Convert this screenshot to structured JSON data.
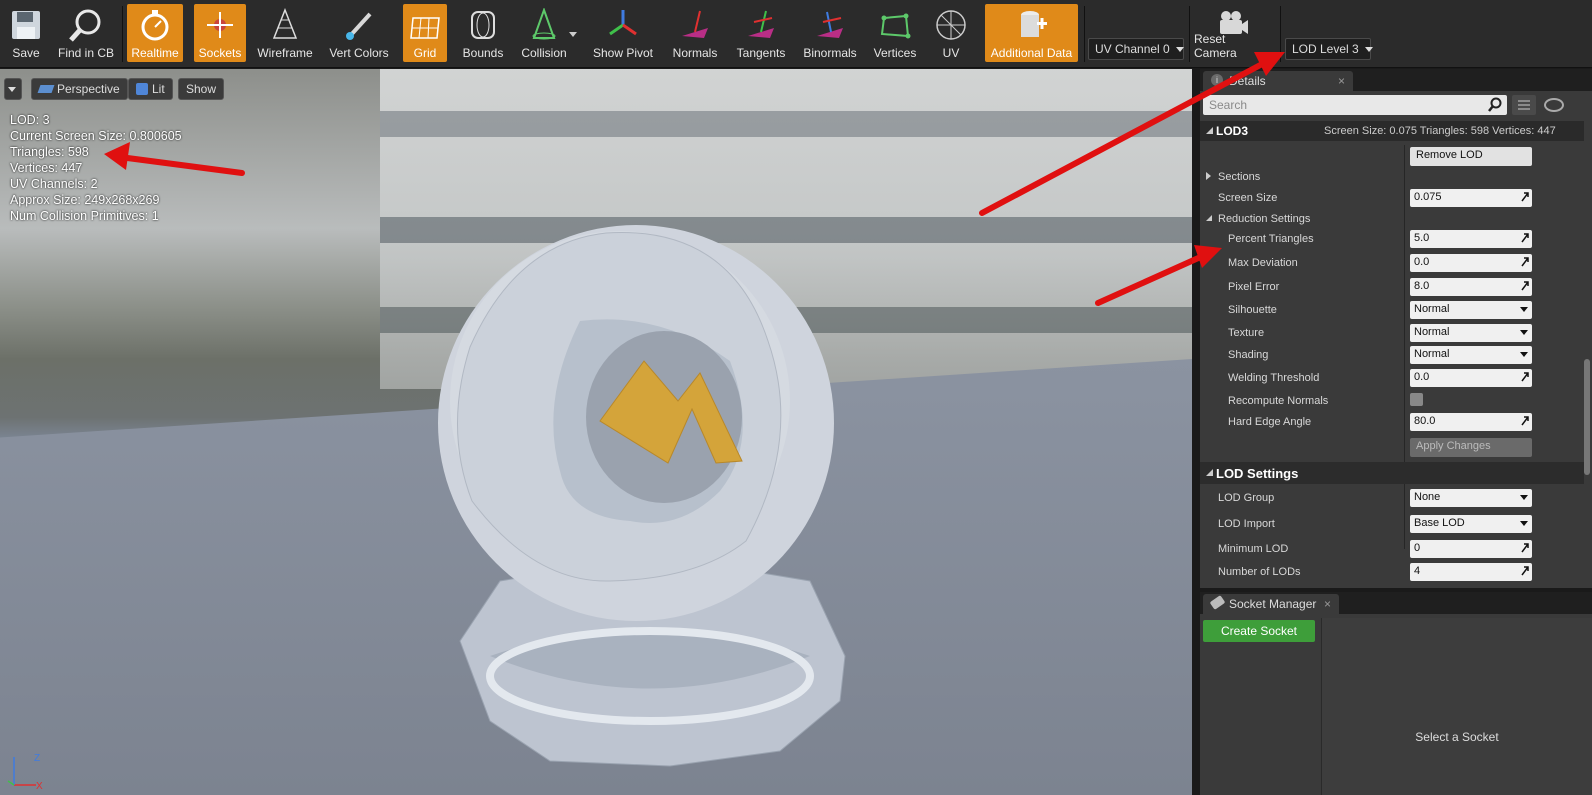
{
  "toolbar": {
    "buttons": [
      {
        "label": "Save",
        "icon": "save-icon"
      },
      {
        "label": "Find in CB",
        "icon": "magnifier-icon"
      },
      {
        "label": "Realtime",
        "icon": "stopwatch-icon",
        "active": true
      },
      {
        "label": "Sockets",
        "icon": "socket-icon",
        "active": true
      },
      {
        "label": "Wireframe",
        "icon": "wireframe-icon"
      },
      {
        "label": "Vert Colors",
        "icon": "brush-icon"
      },
      {
        "label": "Grid",
        "icon": "grid-icon",
        "active": true
      },
      {
        "label": "Bounds",
        "icon": "bounds-icon"
      },
      {
        "label": "Collision",
        "icon": "collision-icon"
      },
      {
        "label": "Show Pivot",
        "icon": "pivot-icon"
      },
      {
        "label": "Normals",
        "icon": "normals-icon"
      },
      {
        "label": "Tangents",
        "icon": "tangents-icon"
      },
      {
        "label": "Binormals",
        "icon": "binormals-icon"
      },
      {
        "label": "Vertices",
        "icon": "vertices-icon"
      },
      {
        "label": "UV",
        "icon": "uv-icon"
      },
      {
        "label": "Additional Data",
        "icon": "additional-data-icon",
        "active": true
      },
      {
        "label": "Reset Camera",
        "icon": "camera-icon"
      }
    ],
    "uv_channel": "UV Channel 0",
    "lod_level": "LOD Level 3"
  },
  "viewport": {
    "perspective": "Perspective",
    "lit": "Lit",
    "show": "Show",
    "stats": [
      "LOD:  3",
      "Current Screen Size:  0.800605",
      "Triangles:  598",
      "Vertices:  447",
      "UV Channels:  2",
      "Approx Size:  249x268x269",
      "Num Collision Primitives:  1"
    ],
    "axis_z": "Z",
    "axis_x": "X"
  },
  "details": {
    "tab": "Details",
    "search_placeholder": "Search",
    "lod_header": "LOD3",
    "lod_info": "Screen Size: 0.075   Triangles: 598   Vertices: 447",
    "remove_lod": "Remove LOD",
    "sections": "Sections",
    "screen_size_label": "Screen Size",
    "screen_size_value": "0.075",
    "reduction_settings": "Reduction Settings",
    "percent_triangles_label": "Percent Triangles",
    "percent_triangles_value": "5.0",
    "max_deviation_label": "Max Deviation",
    "max_deviation_value": "0.0",
    "pixel_error_label": "Pixel Error",
    "pixel_error_value": "8.0",
    "silhouette_label": "Silhouette",
    "silhouette_value": "Normal",
    "texture_label": "Texture",
    "texture_value": "Normal",
    "shading_label": "Shading",
    "shading_value": "Normal",
    "welding_label": "Welding Threshold",
    "welding_value": "0.0",
    "recompute_label": "Recompute Normals",
    "hard_edge_label": "Hard Edge Angle",
    "hard_edge_value": "80.0",
    "apply_changes": "Apply Changes",
    "lod_settings": "LOD Settings",
    "lod_group_label": "LOD Group",
    "lod_group_value": "None",
    "lod_import_label": "LOD Import",
    "lod_import_value": "Base LOD",
    "min_lod_label": "Minimum LOD",
    "min_lod_value": "0",
    "num_lods_label": "Number of LODs",
    "num_lods_value": "4"
  },
  "socket_manager": {
    "tab": "Socket Manager",
    "create": "Create Socket",
    "empty": "Select a Socket"
  },
  "colors": {
    "accent": "#e08a19",
    "create": "#3e9e3a",
    "annotation": "#e01010"
  }
}
